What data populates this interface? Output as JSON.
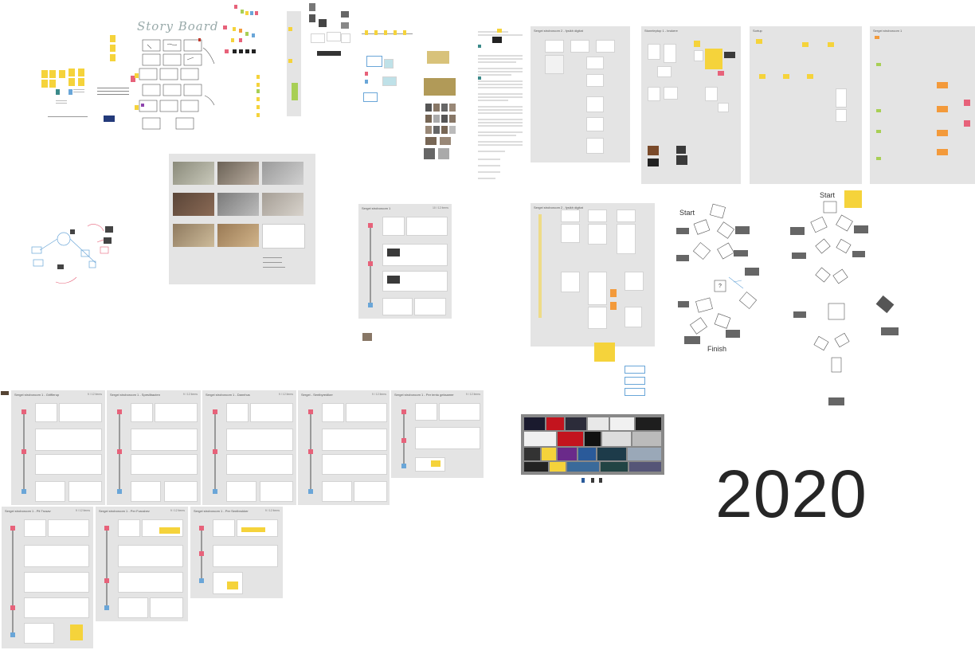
{
  "canvas": {
    "year_label": "2020"
  },
  "labels": {
    "start_left": "Start",
    "start_right": "Start",
    "finish": "Finish",
    "question": "?",
    "storyboard": "Story Board"
  },
  "colors": {
    "panel_bg": "#e4e4e4",
    "sticky_yellow": "#f5d33b",
    "sticky_pink": "#e7627a",
    "sticky_orange": "#f39a3b",
    "sticky_blue": "#6aa6d8",
    "sticky_green": "#a8cf55"
  },
  "panels_top": [
    {
      "title": "Sergei stroboroom 2 - fysikh digitat"
    },
    {
      "title": "Stoneleptop 1 - brukere"
    },
    {
      "title": "Sortup"
    },
    {
      "title": "Sergei stroboroom 1"
    }
  ],
  "flow_panels": [
    {
      "title": "Sergei stroboroom 1",
      "count": "10 / 12 items"
    },
    {
      "title": "Sergei stroboroom 1 - Grifflerup",
      "count": "9 / 12 items"
    },
    {
      "title": "Sergei stroboroom 1 - Spesilbauten",
      "count": "9 / 12 items"
    },
    {
      "title": "Sergei stroboroom 1 - Dannhus",
      "count": "9 / 12 items"
    },
    {
      "title": "Sergei - Sentbyrediker",
      "count": "9 / 12 items"
    },
    {
      "title": "Sergei stroboroom 1 - Per tentu geksamer",
      "count": "9 / 12 items"
    },
    {
      "title": "Sergei stroboroom 1 - Pit Trusav",
      "count": "9 / 12 items"
    },
    {
      "title": "Sergei stroboroom 1 - Per Furusbev",
      "count": "9 / 12 items"
    },
    {
      "title": "Sergei stroboroom 1 - Per Sentbrukker",
      "count": "9 / 12 items"
    }
  ]
}
